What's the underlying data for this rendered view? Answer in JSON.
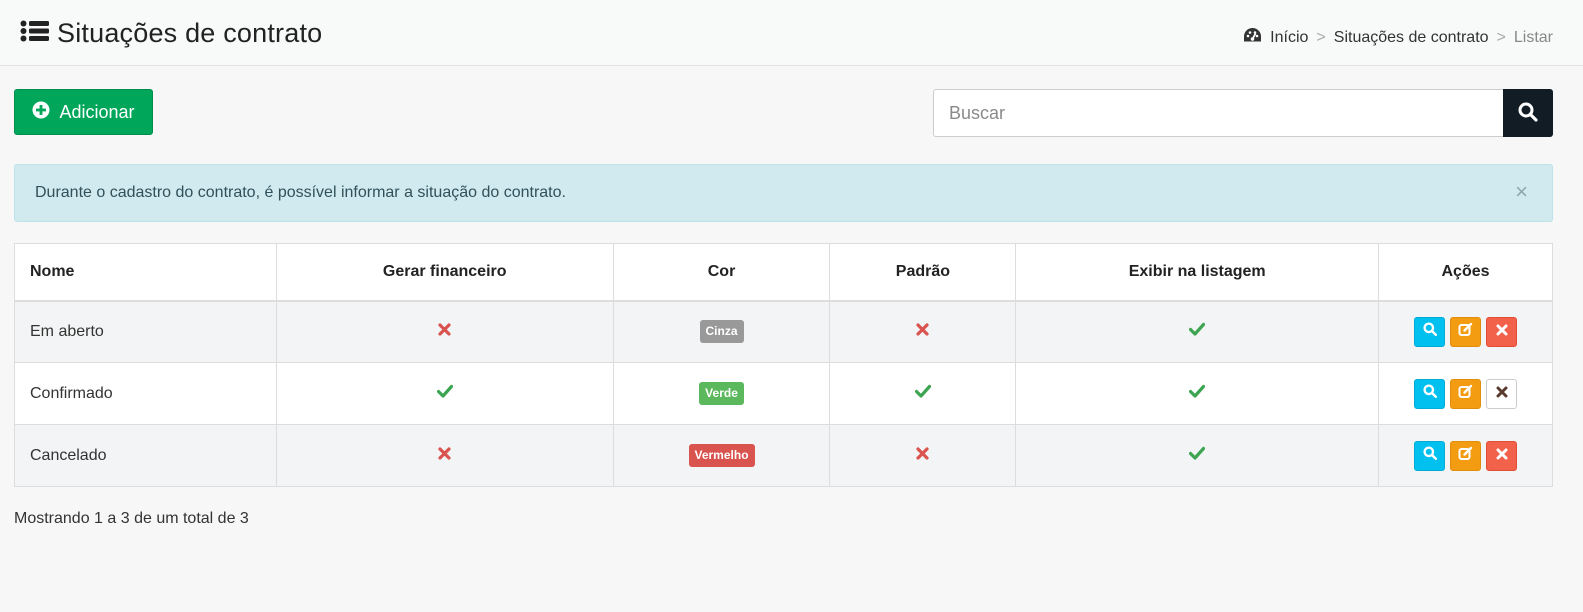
{
  "header": {
    "title": "Situações de contrato",
    "title_icon": "list-icon",
    "breadcrumb": [
      {
        "label": "Início",
        "icon": "dashboard-icon"
      },
      {
        "label": "Situações de contrato"
      },
      {
        "label": "Listar"
      }
    ],
    "separator": ">"
  },
  "toolbar": {
    "add_label": "Adicionar",
    "search_placeholder": "Buscar",
    "search_value": ""
  },
  "alert": {
    "text": "Durante o cadastro do contrato, é possível informar a situação do contrato.",
    "close_symbol": "×"
  },
  "table": {
    "columns": [
      "Nome",
      "Gerar financeiro",
      "Cor",
      "Padrão",
      "Exibir na listagem",
      "Ações"
    ],
    "rows": [
      {
        "nome": "Em aberto",
        "gerar_financeiro": false,
        "cor": "Cinza",
        "cor_hex": "#999999",
        "padrao": false,
        "exibir": true,
        "deletable": true
      },
      {
        "nome": "Confirmado",
        "gerar_financeiro": true,
        "cor": "Verde",
        "cor_hex": "#5cb85c",
        "padrao": true,
        "exibir": true,
        "deletable": false
      },
      {
        "nome": "Cancelado",
        "gerar_financeiro": false,
        "cor": "Vermelho",
        "cor_hex": "#d9534f",
        "padrao": false,
        "exibir": true,
        "deletable": true
      }
    ]
  },
  "footer": {
    "summary": "Mostrando 1 a 3 de um total de 3"
  },
  "colors": {
    "success": "#00a65a",
    "check": "#3da552",
    "cross": "#d9534f",
    "info_bg": "#d1eaef",
    "search_button": "#111c24",
    "view_button": "#00c0ef",
    "edit_button": "#f39c12",
    "delete_button": "#f2624b"
  }
}
